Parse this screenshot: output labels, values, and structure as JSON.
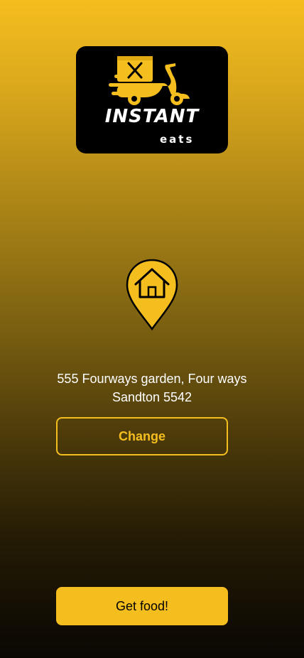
{
  "brand": {
    "name": "INSTANT",
    "tagline": "eats",
    "logo_icon": "delivery-scooter-icon",
    "colors": {
      "accent": "#F5BE1F",
      "card": "#000000",
      "text": "#FFFFFF"
    }
  },
  "location": {
    "icon": "home-location-pin-icon",
    "address_line1": "555 Fourways garden, Four ways",
    "address_line2": "Sandton 5542"
  },
  "actions": {
    "change_label": "Change",
    "get_food_label": "Get food!"
  }
}
